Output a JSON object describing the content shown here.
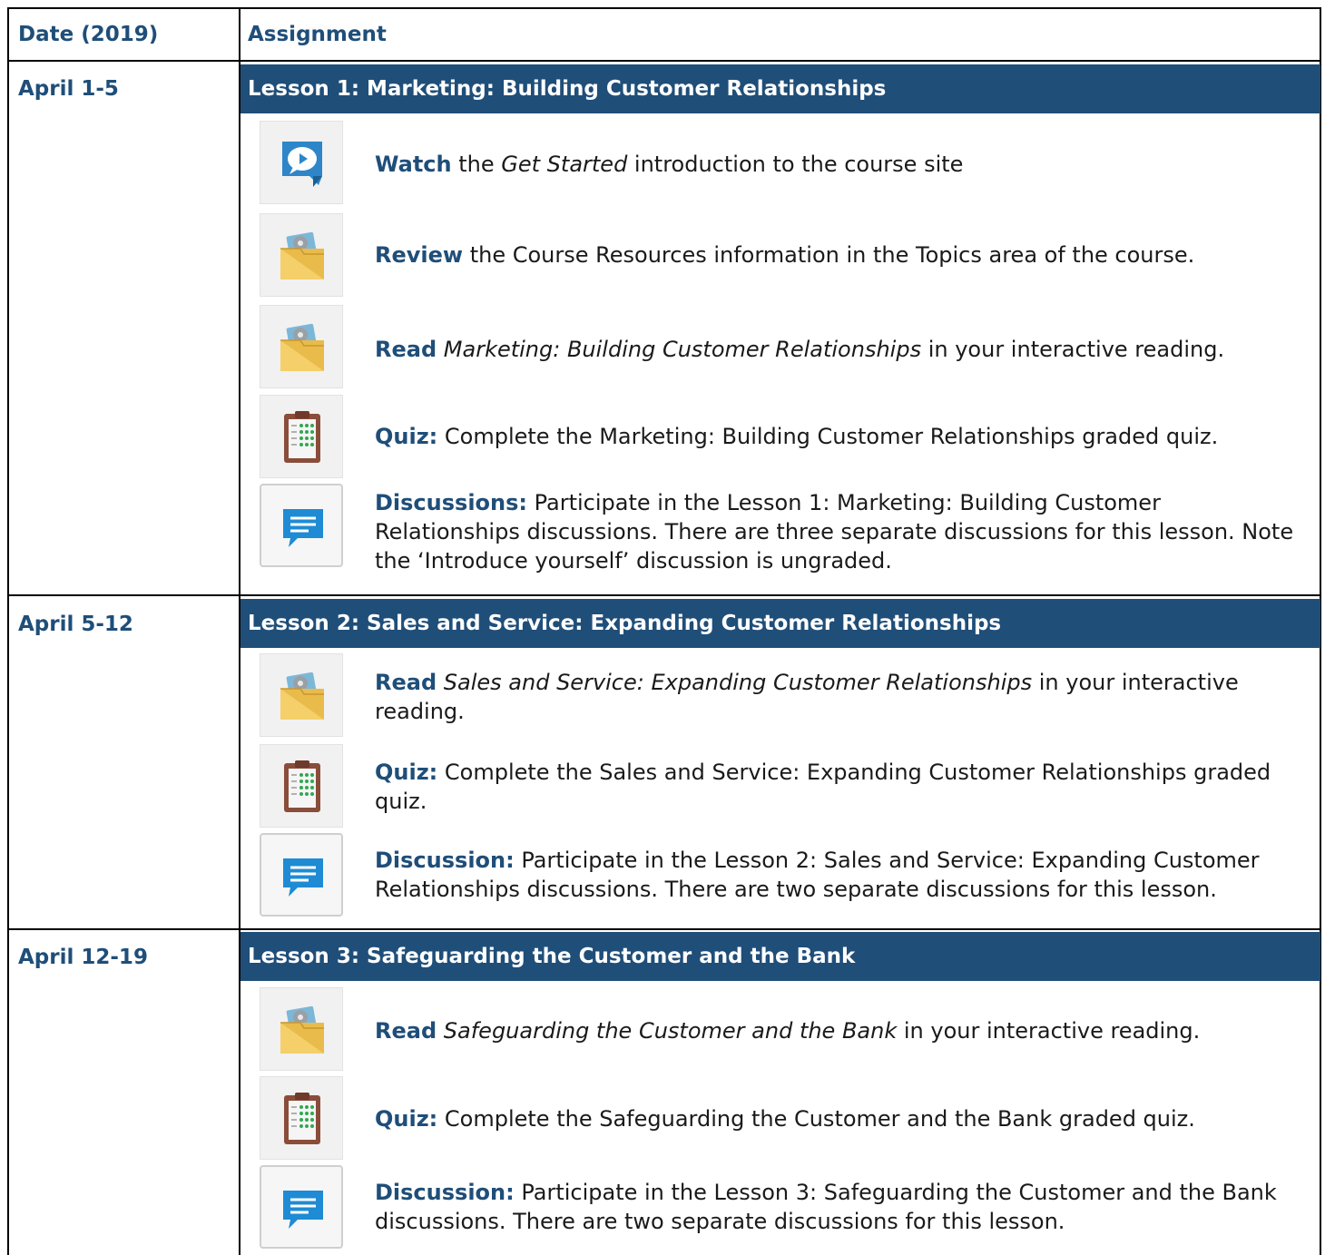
{
  "header": {
    "date_label": "Date (2019)",
    "assignment_label": "Assignment"
  },
  "lessons": [
    {
      "date": "April 1-5",
      "title": "Lesson 1: Marketing: Building Customer Relationships",
      "items": [
        {
          "icon": "video-chat-icon",
          "verb": "Watch",
          "pre": " the ",
          "italic": "Get Started",
          "post": " introduction to the course site"
        },
        {
          "icon": "resources-folder-icon",
          "verb": "Review",
          "pre": " the Course Resources information in the Topics area of the course.",
          "italic": "",
          "post": ""
        },
        {
          "icon": "resources-folder-icon",
          "verb": "Read",
          "pre": " ",
          "italic": "Marketing: Building Customer Relationships",
          "post": " in your interactive reading."
        },
        {
          "icon": "quiz-clipboard-icon",
          "verb": "Quiz:",
          "pre": " Complete the Marketing: Building Customer Relationships graded quiz.",
          "italic": "",
          "post": ""
        },
        {
          "icon": "discussion-bubble-icon",
          "verb": "Discussions:",
          "pre": " Participate in the Lesson 1: Marketing: Building Customer Relationships discussions. There are three separate discussions for this lesson. Note the ‘Introduce yourself’ discussion is ungraded.",
          "italic": "",
          "post": ""
        }
      ]
    },
    {
      "date": "April 5-12",
      "title": "Lesson 2: Sales and Service: Expanding Customer Relationships",
      "items": [
        {
          "icon": "resources-folder-icon",
          "verb": "Read",
          "pre": " ",
          "italic": "Sales and Service: Expanding Customer Relationships",
          "post": " in your interactive reading."
        },
        {
          "icon": "quiz-clipboard-icon",
          "verb": "Quiz:",
          "pre": " Complete the Sales and Service: Expanding Customer Relationships graded quiz.",
          "italic": "",
          "post": ""
        },
        {
          "icon": "discussion-bubble-icon",
          "verb": "Discussion:",
          "pre": " Participate in the Lesson 2: Sales and Service: Expanding Customer Relationships discussions. There are two separate discussions for this lesson.",
          "italic": "",
          "post": ""
        }
      ]
    },
    {
      "date": "April 12-19",
      "title": "Lesson 3: Safeguarding the Customer and the Bank",
      "items": [
        {
          "icon": "resources-folder-icon",
          "verb": "Read",
          "pre": " ",
          "italic": "Safeguarding the Customer and the Bank",
          "post": " in your interactive reading."
        },
        {
          "icon": "quiz-clipboard-icon",
          "verb": "Quiz:",
          "pre": " Complete the Safeguarding the Customer and the Bank graded quiz.",
          "italic": "",
          "post": ""
        },
        {
          "icon": "discussion-bubble-icon",
          "verb": "Discussion:",
          "pre": " Participate in the Lesson 3: Safeguarding the Customer and the Bank discussions. There are two separate discussions for this lesson.",
          "italic": "",
          "post": ""
        }
      ]
    }
  ]
}
